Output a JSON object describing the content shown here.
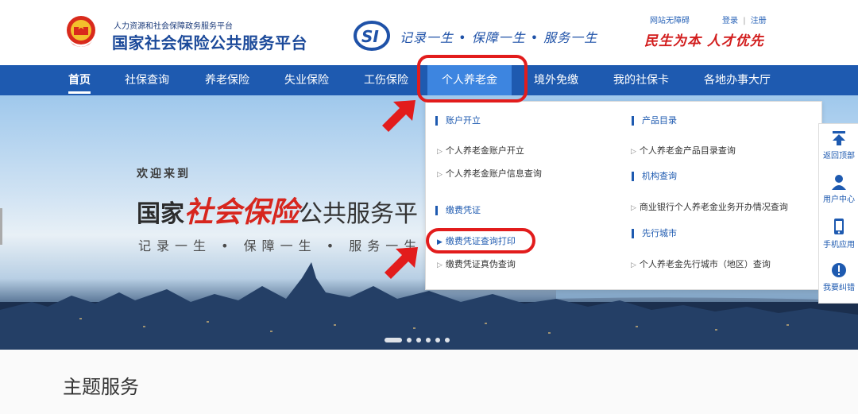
{
  "header": {
    "org_subtitle": "人力资源和社会保障政务服务平台",
    "org_title": "国家社会保险公共服务平台",
    "slogan": "记录一生 • 保障一生 • 服务一生",
    "accessibility_link": "网站无障碍",
    "login_link": "登录",
    "separator": "|",
    "register_link": "注册",
    "motto": "民生为本 人才优先"
  },
  "nav": {
    "items": [
      "首页",
      "社保查询",
      "养老保险",
      "失业保险",
      "工伤保险",
      "个人养老金",
      "境外免缴",
      "我的社保卡",
      "各地办事大厅"
    ]
  },
  "dropdown": {
    "account_category": "账户开立",
    "account_links": [
      "个人养老金账户开立",
      "个人养老金账户信息查询"
    ],
    "voucher_category": "缴费凭证",
    "voucher_links": [
      "缴费凭证查询打印",
      "缴费凭证真伪查询"
    ],
    "product_category": "产品目录",
    "product_links": [
      "个人养老金产品目录查询"
    ],
    "institution_category": "机构查询",
    "institution_links": [
      "商业银行个人养老金业务开办情况查询"
    ],
    "pilot_category": "先行城市",
    "pilot_links": [
      "个人养老金先行城市（地区）查询"
    ]
  },
  "banner": {
    "welcome": "欢迎来到",
    "title_prefix": "国家",
    "title_highlight": "社会保险",
    "title_suffix": "公共服务平",
    "subtitle": "记录一生 • 保障一生 • 服务一生"
  },
  "sidebar": {
    "items": [
      "返回顶部",
      "用户中心",
      "手机应用",
      "我要纠错"
    ]
  },
  "section": {
    "theme_title": "主题服务"
  },
  "colors": {
    "nav_blue": "#1e5ab0",
    "nav_active": "#3d85e0",
    "highlight_red": "#e21c1c",
    "motto_red": "#d21d1d"
  }
}
